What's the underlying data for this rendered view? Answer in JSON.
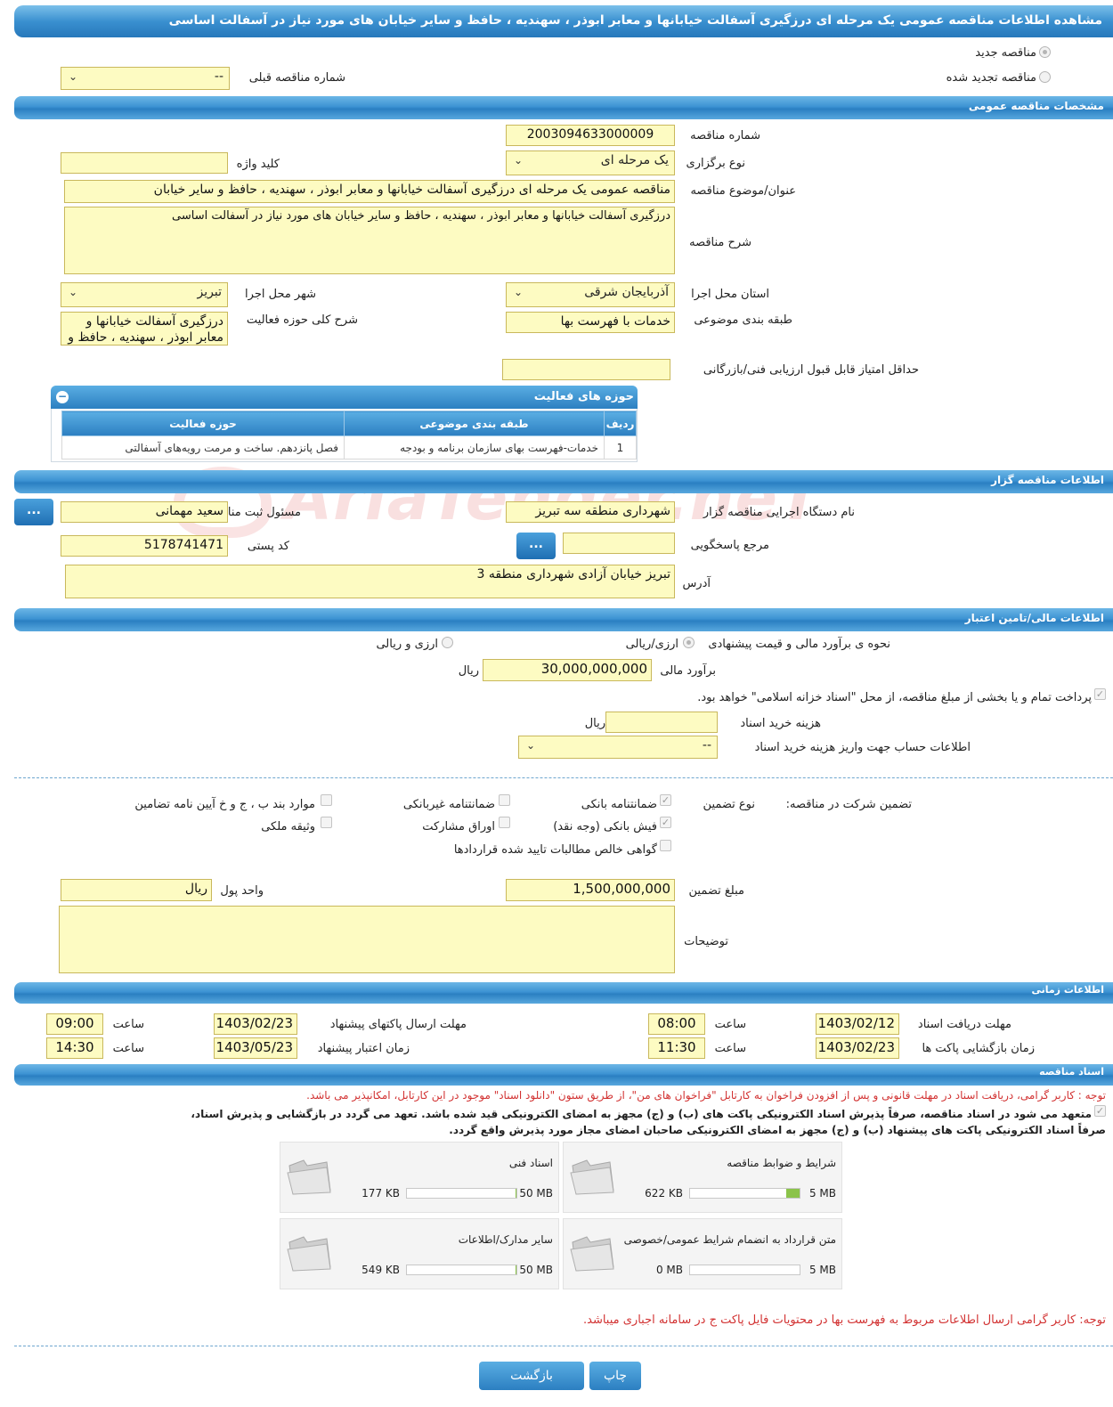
{
  "page_title": "مشاهده اطلاعات مناقصه عمومی یک مرحله ای درزگیری آسفالت خیابانها و معابر ابوذر ، سهندیه ، حافظ و سایر خیابان های مورد نیاز در آسفالت اساسی",
  "tender_type": {
    "new_label": "مناقصه جدید",
    "renewed_label": "مناقصه تجدید شده",
    "prev_number_label": "شماره مناقصه قبلی",
    "prev_number_value": "--"
  },
  "general": {
    "section_title": "مشخصات مناقصه عمومی",
    "number_label": "شماره مناقصه",
    "number_value": "2003094633000009",
    "holding_type_label": "نوع برگزاری",
    "holding_type_value": "یک مرحله ای",
    "keyword_label": "کلید واژه",
    "keyword_value": "",
    "subject_label": "عنوان/موضوع مناقصه",
    "subject_value": "مناقصه عمومی یک مرحله ای درزگیری آسفالت خیابانها و معابر ابوذر ، سهندیه ، حافظ و سایر خیابان",
    "description_label": "شرح مناقصه",
    "description_value": "درزگیری آسفالت خیابانها و معابر ابوذر ، سهندیه ، حافظ و سایر خیابان های مورد نیاز در آسفالت اساسی",
    "province_label": "استان محل اجرا",
    "province_value": "آذربایجان شرقی",
    "city_label": "شهر محل اجرا",
    "city_value": "تبریز",
    "category_label": "طبقه بندی موضوعی",
    "category_value": "خدمات با فهرست بها",
    "activity_desc_label": "شرح کلی حوزه فعالیت",
    "activity_desc_value": "درزگیری آسفالت خیابانها و معابر ابوذر ، سهندیه ، حافظ و",
    "min_score_label": "حداقل امتیاز قابل قبول ارزیابی فنی/بازرگانی",
    "min_score_value": ""
  },
  "activities": {
    "title": "حوزه های فعالیت",
    "headers": [
      "ردیف",
      "طبقه بندی موضوعی",
      "حوزه فعالیت"
    ],
    "rows": [
      {
        "row": "1",
        "category": "خدمات-فهرست بهای سازمان برنامه و بودجه",
        "field": "فصل پانزدهم. ساخت و مرمت رویه‌های آسفالتی"
      }
    ]
  },
  "organizer": {
    "section_title": "اطلاعات مناقصه گزار",
    "org_label": "نام دستگاه اجرایی مناقصه گزار",
    "org_value": "شهرداری منطقه سه تبریز",
    "registrar_label": "مسئول ثبت مناقصه",
    "registrar_value": "سعید مهمانی",
    "responder_label": "مرجع پاسخگویی",
    "responder_value": "",
    "postal_label": "کد پستی",
    "postal_value": "5178741471",
    "address_label": "آدرس",
    "address_value": "تبریز خیابان آزادی شهرداری منطقه 3",
    "dots_label": "..."
  },
  "finance": {
    "section_title": "اطلاعات مالی/تامین اعتبار",
    "estimate_method_label": "نحوه ی برآورد مالی و قیمت پیشنهادی",
    "opt_rial": "ارزی/ریالی",
    "opt_fx_rial": "ارزی و ریالی",
    "estimate_label": "برآورد مالی",
    "estimate_value": "30,000,000,000",
    "estimate_unit": "ریال",
    "treasury_label": "پرداخت تمام و یا بخشی از مبلغ مناقصه، از محل \"اسناد خزانه اسلامی\" خواهد بود.",
    "doc_cost_label": "هزینه خرید اسناد",
    "doc_cost_value": "",
    "doc_cost_unit": "ریال",
    "account_label": "اطلاعات حساب جهت واریز هزینه خرید اسناد",
    "account_value": "--"
  },
  "guarantee": {
    "label": "تضمین شرکت در مناقصه:",
    "type_label": "نوع تضمین",
    "bank_guarantee": "ضمانتنامه بانکی",
    "nonbank_guarantee": "ضمانتنامه غیربانکی",
    "clauses": "موارد بند ب ، ج و خ آیین نامه تضامین",
    "bank_receipt": "فیش بانکی (وجه نقد)",
    "participation_bonds": "اوراق مشارکت",
    "property_collateral": "وثیقه ملکی",
    "claims_certificate": "گواهی خالص مطالبات تایید شده قراردادها",
    "amount_label": "مبلغ تضمین",
    "amount_value": "1,500,000,000",
    "currency_label": "واحد پول",
    "currency_value": "ریال",
    "notes_label": "توضیحات",
    "notes_value": ""
  },
  "timing": {
    "section_title": "اطلاعات زمانی",
    "doc_receive_label": "مهلت دریافت اسناد",
    "doc_receive_date": "1403/02/12",
    "doc_receive_time": "08:00",
    "submit_label": "مهلت ارسال پاکتهای پیشنهاد",
    "submit_date": "1403/02/23",
    "submit_time": "09:00",
    "open_label": "زمان بازگشایی پاکت ها",
    "open_date": "1403/02/23",
    "open_time": "11:30",
    "validity_label": "زمان اعتبار پیشنهاد",
    "validity_date": "1403/05/23",
    "validity_time": "14:30",
    "time_label": "ساعت"
  },
  "documents": {
    "section_title": "اسناد مناقصه",
    "notice": "توجه : کاربر گرامی، دریافت اسناد در مهلت قانونی و پس از افزودن فراخوان به کارتابل \"فراخوان های من\"، از طریق ستون \"دانلود اسناد\" موجود در این کارتابل، امکانپذیر می باشد.",
    "commitment_1": "متعهد می شود در اسناد مناقصه، صرفاً پذیرش اسناد الکترونیکی پاکت های (ب) و (ج) مجهز به امضای الکترونیکی قید شده باشد. تعهد می گردد در بازگشایی و پذیرش اسناد،",
    "commitment_2": "صرفاً اسناد الکترونیکی پاکت های پیشنهاد (ب) و (ج) مجهز به امضای الکترونیکی صاحبان امضای مجاز مورد پذیرش واقع گردد.",
    "items": [
      {
        "title": "شرایط و ضوابط مناقصه",
        "size": "622 KB",
        "max": "5 MB",
        "fill": 0.12
      },
      {
        "title": "اسناد فنی",
        "size": "177 KB",
        "max": "50 MB",
        "fill": 0.01
      },
      {
        "title": "متن قرارداد به انضمام شرایط عمومی/خصوصی",
        "size": "0 MB",
        "max": "5 MB",
        "fill": 0.0
      },
      {
        "title": "سایر مدارک/اطلاعات",
        "size": "549 KB",
        "max": "50 MB",
        "fill": 0.01
      }
    ],
    "price_list_notice": "توجه: کاربر گرامی ارسال اطلاعات مربوط به فهرست بها در محتویات فایل پاکت ج در سامانه اجباری میباشد."
  },
  "buttons": {
    "back": "بازگشت",
    "print": "چاپ"
  },
  "watermark": "AriaTender.neT"
}
